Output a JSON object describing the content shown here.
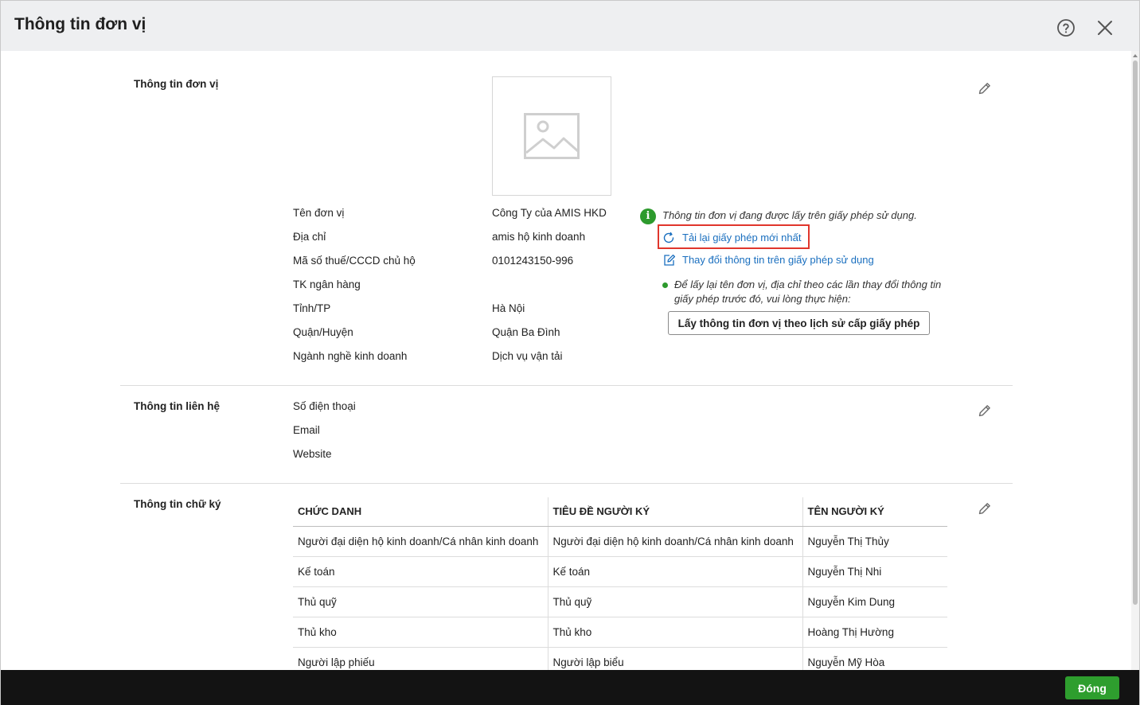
{
  "dialog": {
    "title": "Thông tin đơn vị"
  },
  "unit_info": {
    "section_title": "Thông tin đơn vị",
    "fields": [
      {
        "label": "Tên đơn vị",
        "value": "Công Ty của AMIS HKD"
      },
      {
        "label": "Địa chỉ",
        "value": "amis hộ kinh doanh"
      },
      {
        "label": "Mã số thuế/CCCD chủ hộ",
        "value": "0101243150-996"
      },
      {
        "label": "TK ngân hàng",
        "value": ""
      },
      {
        "label": "Tỉnh/TP",
        "value": "Hà Nội"
      },
      {
        "label": "Quận/Huyện",
        "value": "Quận Ba Đình"
      },
      {
        "label": "Ngành nghề kinh doanh",
        "value": "Dịch vụ vận tải"
      }
    ],
    "license_info": "Thông tin đơn vị đang được lấy trên giấy phép sử dụng.",
    "reload_link": "Tải lại giấy phép mới nhất",
    "change_link": "Thay đổi thông tin trên giấy phép sử dụng",
    "history_note": "Để lấy lại tên đơn vị, địa chỉ theo các lần thay đổi thông tin giấy phép trước đó, vui lòng thực hiện:",
    "history_button": "Lấy thông tin đơn vị theo lịch sử cấp giấy phép"
  },
  "contact_info": {
    "section_title": "Thông tin liên hệ",
    "fields": [
      {
        "label": "Số điện thoại",
        "value": ""
      },
      {
        "label": "Email",
        "value": ""
      },
      {
        "label": "Website",
        "value": ""
      }
    ]
  },
  "signature_info": {
    "section_title": "Thông tin chữ ký",
    "columns": [
      "CHỨC DANH",
      "TIÊU ĐỀ NGƯỜI KÝ",
      "TÊN NGƯỜI KÝ"
    ],
    "rows": [
      [
        "Người đại diện hộ kinh doanh/Cá nhân kinh doanh",
        "Người đại diện hộ kinh doanh/Cá nhân kinh doanh",
        "Nguyễn Thị Thủy"
      ],
      [
        "Kế toán",
        "Kế toán",
        "Nguyễn Thị Nhi"
      ],
      [
        "Thủ quỹ",
        "Thủ quỹ",
        "Nguyễn Kim Dung"
      ],
      [
        "Thủ kho",
        "Thủ kho",
        "Hoàng Thị Hường"
      ],
      [
        "Người lập phiếu",
        "Người lập biểu",
        "Nguyễn Mỹ Hòa"
      ]
    ]
  },
  "footer": {
    "close_button": "Đóng"
  },
  "colors": {
    "accent_green": "#2e9e2e",
    "link_blue": "#1a6fbf",
    "highlight_red": "#e0362c",
    "footer_bg": "#131313"
  }
}
